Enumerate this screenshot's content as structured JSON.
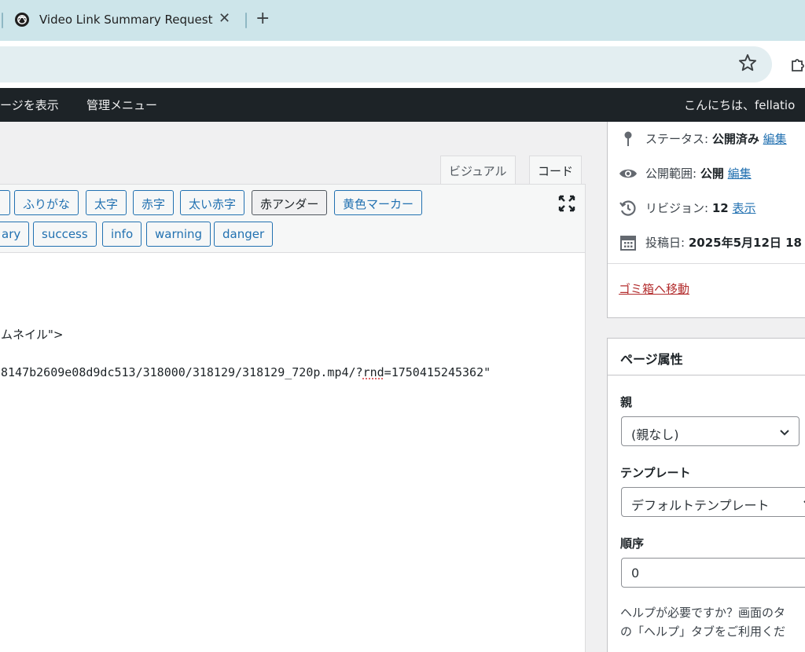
{
  "browser": {
    "tab_title": "Video Link Summary Request",
    "tab_close": "✕",
    "new_tab": "+"
  },
  "adminbar": {
    "view_page": "ージを表示",
    "admin_menu": "管理メニュー",
    "greeting": "こんにちは、fellatio"
  },
  "editor": {
    "tabs": {
      "visual": "ビジュアル",
      "code": "コード"
    },
    "buttons_row1": [
      "ふりがな",
      "太字",
      "赤字",
      "太い赤字",
      "赤アンダー",
      "黄色マーカー"
    ],
    "buttons_row2_partial": "ary",
    "buttons_row2": [
      "success",
      "info",
      "warning",
      "danger"
    ],
    "code": {
      "line1": "ムネイル\">",
      "line2_pre": "8147b2609e08d9dc513/318000/318129/318129_720p.mp4/?",
      "line2_spell": "rnd",
      "line2_post": "=1750415245362\""
    }
  },
  "publish": {
    "status_label": "ステータス: ",
    "status_value": "公開済み",
    "visibility_label": "公開範囲: ",
    "visibility_value": "公開",
    "revisions_label": "リビジョン: ",
    "revisions_value": "12",
    "date_label": "投稿日: ",
    "date_value": "2025年5月12日 18",
    "edit_link": "編集",
    "show_link": "表示",
    "trash": "ゴミ箱へ移動"
  },
  "page_attributes": {
    "title": "ページ属性",
    "parent_label": "親",
    "parent_value": "(親なし)",
    "template_label": "テンプレート",
    "template_value": "デフォルトテンプレート",
    "order_label": "順序",
    "order_value": "0",
    "help_line1": "ヘルプが必要ですか？画面のタ",
    "help_line2": "の「ヘルプ」タブをご利用くだ"
  }
}
